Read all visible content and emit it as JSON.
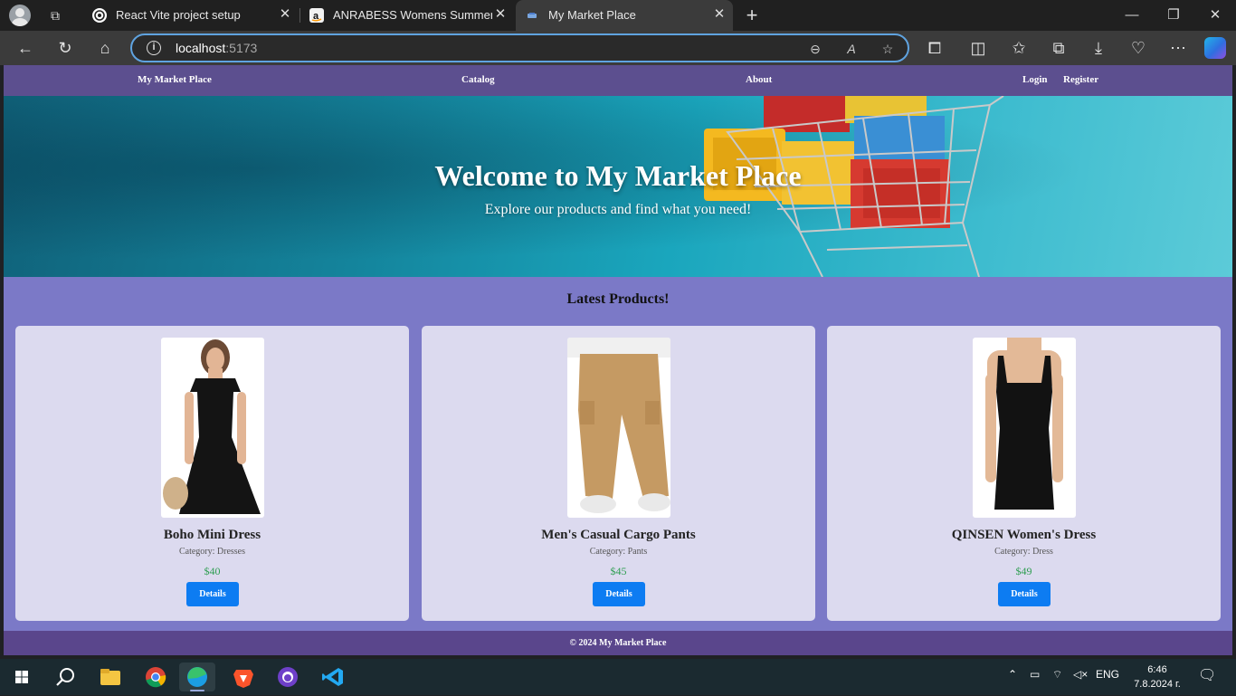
{
  "browser": {
    "tabs": [
      {
        "title": "React Vite project setup",
        "favicon": "chatgpt-icon"
      },
      {
        "title": "ANRABESS Womens Summer Ca",
        "favicon": "amazon-icon"
      },
      {
        "title": "My Market Place",
        "favicon": "page-icon",
        "active": true
      }
    ],
    "address": {
      "host": "localhost",
      "port": ":5173"
    }
  },
  "nav": {
    "brand": "My Market Place",
    "catalog": "Catalog",
    "about": "About",
    "login": "Login",
    "register": "Register"
  },
  "hero": {
    "title": "Welcome to My Market Place",
    "subtitle": "Explore our products and find what you need!"
  },
  "latest": {
    "heading": "Latest Products!"
  },
  "products": [
    {
      "name": "Boho Mini Dress",
      "category": "Category: Dresses",
      "price": "$40",
      "button": "Details"
    },
    {
      "name": "Men's Casual Cargo Pants",
      "category": "Category: Pants",
      "price": "$45",
      "button": "Details"
    },
    {
      "name": "QINSEN Women's Dress",
      "category": "Category: Dress",
      "price": "$49",
      "button": "Details"
    }
  ],
  "footer": {
    "text": "© 2024 My Market Place"
  },
  "taskbar": {
    "language": "ENG",
    "time": "6:46",
    "date": "7.8.2024 г."
  },
  "colors": {
    "nav": "#5c4f8f",
    "page_bg": "#7b79c7",
    "card_bg": "#dcdaef",
    "button": "#0d7cf2",
    "price": "#2f9e52",
    "footer": "#5a468c"
  }
}
